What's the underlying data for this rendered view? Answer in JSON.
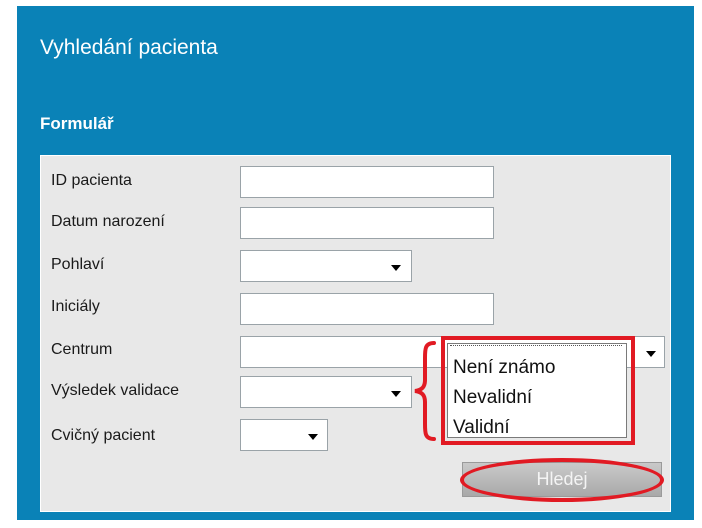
{
  "header": {
    "title": "Vyhledání pacienta"
  },
  "form": {
    "section_title": "Formulář",
    "fields": {
      "patient_id": {
        "label": "ID pacienta",
        "value": ""
      },
      "birth_date": {
        "label": "Datum narození",
        "value": ""
      },
      "sex": {
        "label": "Pohlaví",
        "value": ""
      },
      "initials": {
        "label": "Iniciály",
        "value": ""
      },
      "center": {
        "label": "Centrum",
        "value": ""
      },
      "validation_result": {
        "label": "Výsledek validace",
        "value": ""
      },
      "practice_patient": {
        "label": "Cvičný pacient",
        "value": ""
      }
    },
    "validation_dropdown": {
      "options": [
        "Není známo",
        "Nevalidní",
        "Validní"
      ]
    },
    "search_button_label": "Hledej"
  },
  "colors": {
    "panel_bg": "#0a82b7",
    "form_bg": "#e8e8e8",
    "annotation": "#e11a23"
  },
  "icons": [
    "chevron-down-icon",
    "curly-brace-annotation"
  ]
}
